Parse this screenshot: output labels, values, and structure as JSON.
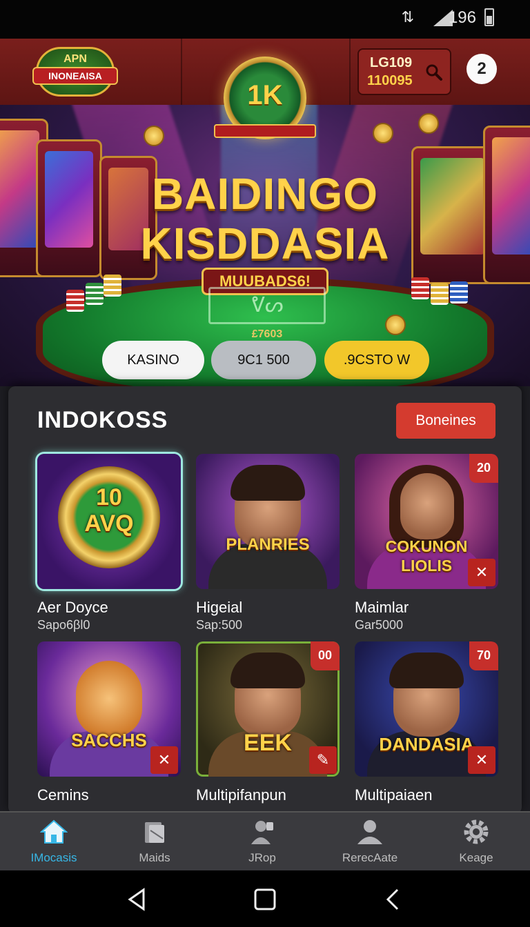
{
  "status_bar": {
    "signal_text": "⇅",
    "battery_level": "196"
  },
  "header": {
    "logo": {
      "top_text": "APN",
      "ribbon_text": "INONEAISA"
    },
    "medal_value": "1K",
    "balance": {
      "line1": "LG109",
      "line2": "110095"
    },
    "notification_count": "2"
  },
  "hero": {
    "title_line1": "BAIDINGO",
    "title_line2": "KISDDASIA",
    "plate_text": "MUUBADS6!",
    "table_mark": "ᕓᔕ",
    "table_number": "£7603",
    "pills": [
      {
        "label": "KASINO",
        "color": "#f4f4f4"
      },
      {
        "label": "9C1 500",
        "color": "#b9bdc2"
      },
      {
        "label": ".9CSTO W",
        "color": "#f2c72a"
      }
    ]
  },
  "section": {
    "title": "INDOKOSS",
    "action_label": "Boneines",
    "games": [
      {
        "art_title": "10\nAVQ",
        "name": "Aer Doyce",
        "sub": "Sapo6βl0",
        "tag": "",
        "selected": true
      },
      {
        "art_title": "PLANRIES",
        "name": "Higeial",
        "sub": "Sap:500",
        "tag": "",
        "selected": false
      },
      {
        "art_title": "COKUNON\nLIOLIS",
        "name": "Maimlar",
        "sub": "Gar5000",
        "tag": "20",
        "selected": false
      },
      {
        "art_title": "SACCHS",
        "name": "Cemins",
        "sub": "",
        "tag": "",
        "selected": false
      },
      {
        "art_title": "EEK",
        "name": "Multipifanpun",
        "sub": "",
        "tag": "00",
        "selected": false
      },
      {
        "art_title": "DANDASIA",
        "name": "Multipaiaen",
        "sub": "",
        "tag": "70",
        "selected": false
      }
    ]
  },
  "bottom_nav": [
    {
      "label": "IMocasis",
      "icon": "home-icon",
      "active": true
    },
    {
      "label": "Maids",
      "icon": "cards-icon",
      "active": false
    },
    {
      "label": "JRop",
      "icon": "player-icon",
      "active": false
    },
    {
      "label": "RerecAate",
      "icon": "person-icon",
      "active": false
    },
    {
      "label": "Keage",
      "icon": "gear-icon",
      "active": false
    }
  ],
  "colors": {
    "accent": "#d43b2f",
    "header": "#7a1f1c",
    "active_nav": "#37b7e6",
    "gold": "#ffd24a"
  }
}
